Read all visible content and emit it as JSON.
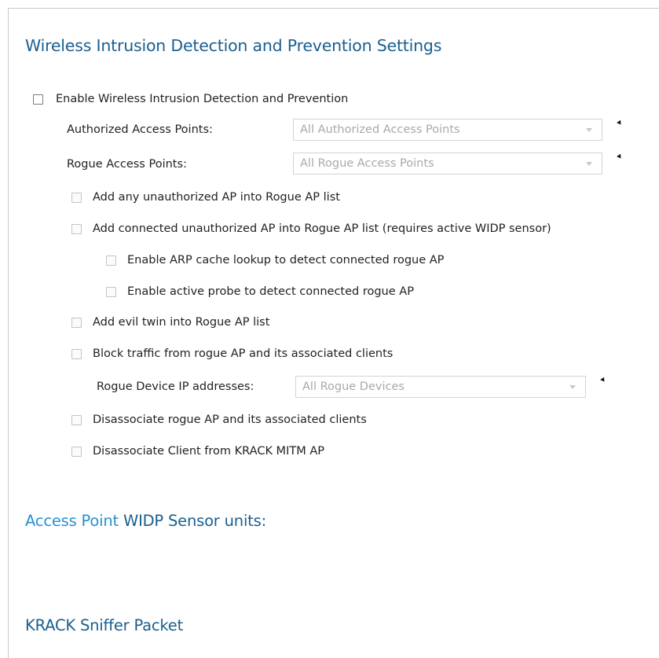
{
  "sections": {
    "main_title": "Wireless Intrusion Detection and Prevention Settings",
    "sensor_title_accent": "Access Point",
    "sensor_title_rest": " WIDP Sensor units:",
    "krack_title": "KRACK Sniffer Packet"
  },
  "enable": {
    "label": "Enable Wireless Intrusion Detection and Prevention",
    "checked": false
  },
  "fields": {
    "authorized_ap_label": "Authorized Access Points:",
    "authorized_ap_value": "All Authorized Access Points",
    "rogue_ap_label": "Rogue Access Points:",
    "rogue_ap_value": "All Rogue Access Points",
    "rogue_ip_label": "Rogue Device IP addresses:",
    "rogue_ip_value": "All Rogue Devices"
  },
  "options": {
    "add_unauthorized": "Add any unauthorized AP into Rogue AP list",
    "add_connected": "Add connected unauthorized AP into Rogue AP list (requires active WIDP sensor)",
    "arp_lookup": "Enable ARP cache lookup to detect connected rogue AP",
    "active_probe": "Enable active probe to detect connected rogue AP",
    "evil_twin": "Add evil twin into Rogue AP list",
    "block_traffic": "Block traffic from rogue AP and its associated clients",
    "disassociate_rogue": "Disassociate rogue AP and its associated clients",
    "disassociate_krack": "Disassociate Client from KRACK MITM AP"
  },
  "colors": {
    "section_title": "#1a5f8f",
    "sensor_accent": "#2a8fd0",
    "disabled_text": "#a9a9a9"
  }
}
